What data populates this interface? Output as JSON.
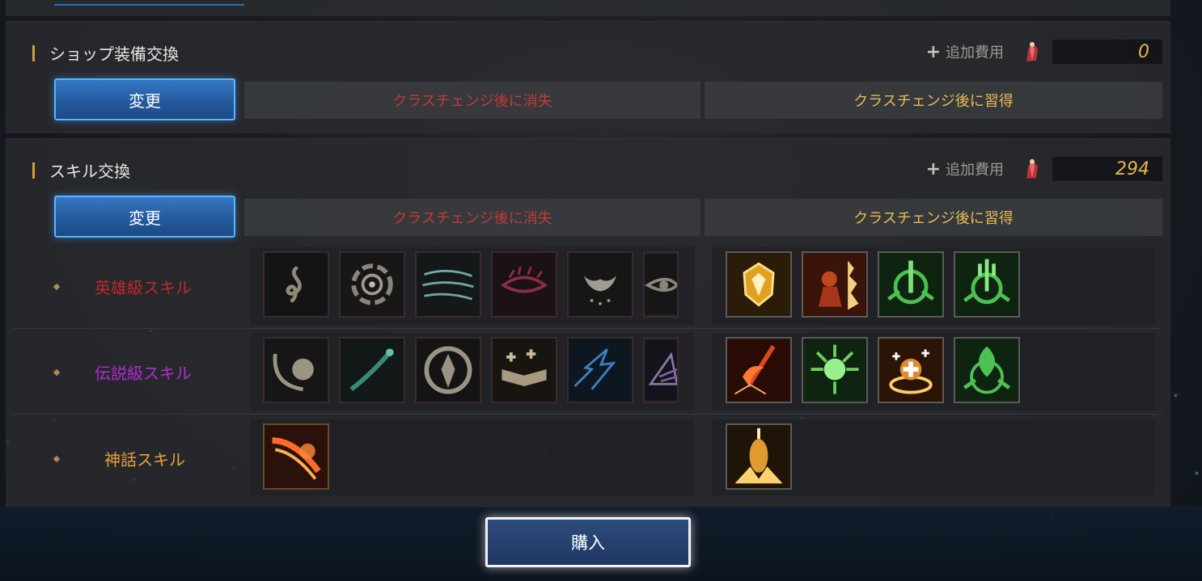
{
  "shop_exchange": {
    "title": "ショップ装備交換",
    "cost_plus": "+",
    "cost_label": "追加費用",
    "cost_value": "0",
    "change_button": "変更",
    "lost_header": "クラスチェンジ後に消失",
    "gain_header": "クラスチェンジ後に習得"
  },
  "skill_exchange": {
    "title": "スキル交換",
    "cost_plus": "+",
    "cost_label": "追加費用",
    "cost_value": "294",
    "change_button": "変更",
    "lost_header": "クラスチェンジ後に消失",
    "gain_header": "クラスチェンジ後に習得",
    "rows": [
      {
        "label": "英雄級スキル",
        "color": "#c0282a",
        "lost_icons": [
          "swirl-flame-icon",
          "vortex-icon",
          "wind-lines-icon",
          "red-eye-icon",
          "wings-hands-icon",
          "eye-icon"
        ],
        "gain_icons": [
          "golden-shield-icon",
          "fire-warrior-icon",
          "green-sword-emblem-icon",
          "green-trident-emblem-icon"
        ]
      },
      {
        "label": "伝説級スキル",
        "color": "#b62ad4",
        "lost_icons": [
          "leaf-curve-icon",
          "comet-icon",
          "totem-circle-icon",
          "spellbook-icon",
          "lightning-dragon-icon",
          "prism-icon"
        ],
        "gain_icons": [
          "flame-axe-icon",
          "green-burst-icon",
          "golden-heal-icon",
          "green-tree-emblem-icon"
        ]
      },
      {
        "label": "神話スキル",
        "color": "#e6a23c",
        "lost_icons": [
          "fire-claw-icon"
        ],
        "gain_icons": [
          "golden-pillar-icon"
        ]
      }
    ]
  },
  "purchase_button": "購入"
}
